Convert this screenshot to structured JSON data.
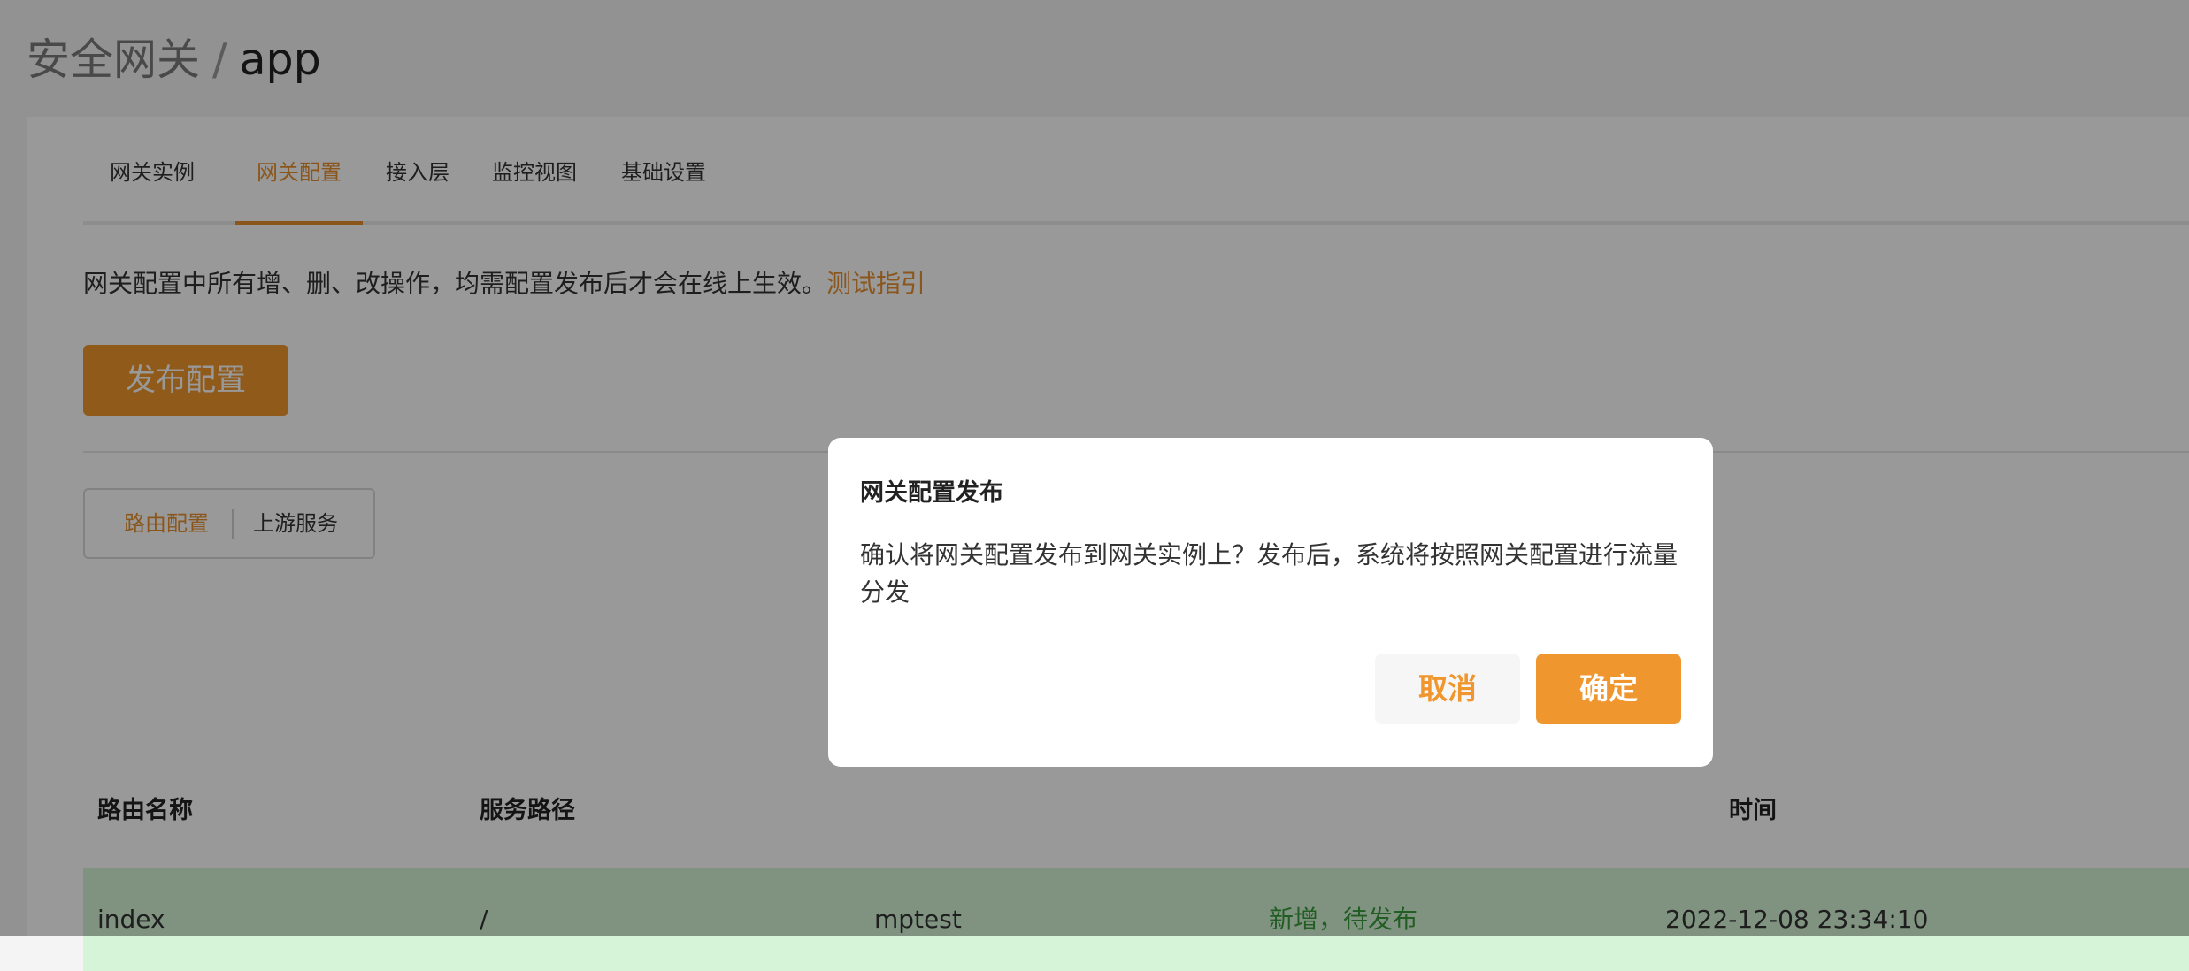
{
  "breadcrumb": {
    "parent": "安全网关",
    "separator": "/",
    "current": "app"
  },
  "tabs": [
    {
      "label": "网关实例"
    },
    {
      "label": "网关配置"
    },
    {
      "label": "接入层"
    },
    {
      "label": "监控视图"
    },
    {
      "label": "基础设置"
    }
  ],
  "notice": {
    "text": "网关配置中所有增、删、改操作，均需配置发布后才会在线上生效。",
    "link": "测试指引"
  },
  "publish_button": "发布配置",
  "segmented": [
    {
      "label": "路由配置"
    },
    {
      "label": "上游服务"
    }
  ],
  "table": {
    "columns": [
      "路由名称",
      "服务路径",
      "",
      "",
      "时间"
    ],
    "rows": [
      {
        "name": "index",
        "path": "/",
        "service": "mptest",
        "status": "新增，待发布",
        "time": "2022-12-08 23:34:10"
      }
    ]
  },
  "modal": {
    "title": "网关配置发布",
    "body": "确认将网关配置发布到网关实例上？发布后，系统将按照网关配置进行流量分发",
    "cancel": "取消",
    "confirm": "确定"
  },
  "colors": {
    "accent": "#f0962e",
    "status_text": "#3a9b3d",
    "row_highlight": "#d6f5d8"
  }
}
